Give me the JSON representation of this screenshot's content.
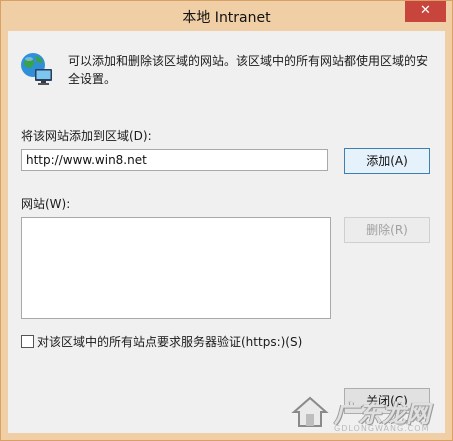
{
  "window": {
    "title": "本地 Intranet",
    "close_glyph": "✕"
  },
  "dialog": {
    "description": "可以添加和删除该区域的网站。该区域中的所有网站都使用区域的安全设置。",
    "add_label": "将该网站添加到区域(D):",
    "url_value": "http://www.win8.net",
    "add_button": "添加(A)",
    "sites_label": "网站(W):",
    "sites": [],
    "remove_button": "删除(R)",
    "https_checkbox_label": "对该区域中的所有站点要求服务器验证(https:)(S)",
    "https_checked": false,
    "close_button": "关闭(C)"
  },
  "icons": {
    "dialog": "globe-network-icon",
    "close": "close-icon",
    "watermark": "house-logo-icon"
  },
  "watermark": {
    "text": "广东龙网",
    "sub": "GDLONGWANG.COM"
  },
  "colors": {
    "frame": "#f0cfa6",
    "close_button": "#c7453c",
    "client": "#f0f0f0"
  }
}
